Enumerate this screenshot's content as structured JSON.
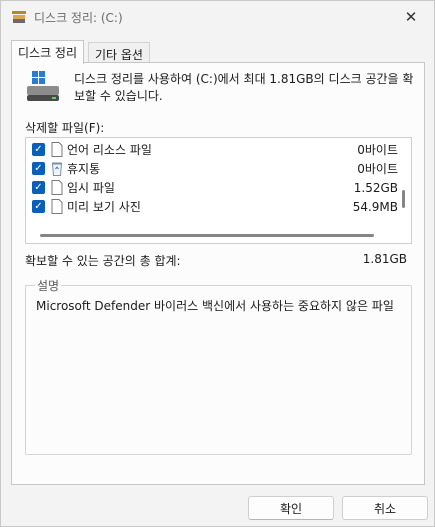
{
  "window": {
    "title": "디스크 정리: (C:)",
    "close_glyph": "✕",
    "icon": "disk-cleanup-icon"
  },
  "tabs": [
    {
      "label": "디스크 정리",
      "active": true
    },
    {
      "label": "기타 옵션",
      "active": false
    }
  ],
  "panel": {
    "intro_text": "디스크 정리를 사용하여 (C:)에서 최대 1.81GB의 디스크 공간을 확보할 수 있습니다.",
    "files_label": "삭제할 파일(F):",
    "files": [
      {
        "name": "언어 리소스 파일",
        "size": "0바이트",
        "checked": true,
        "icon": "file-icon"
      },
      {
        "name": "휴지통",
        "size": "0바이트",
        "checked": true,
        "icon": "recycle-bin-icon"
      },
      {
        "name": "임시 파일",
        "size": "1.52GB",
        "checked": true,
        "icon": "file-icon"
      },
      {
        "name": "미리 보기 사진",
        "size": "54.9MB",
        "checked": true,
        "icon": "file-icon"
      }
    ],
    "total_label": "확보할 수 있는 공간의 총 합계:",
    "total_value": "1.81GB",
    "description_title": "설명",
    "description_text": "Microsoft Defender 바이러스 백신에서 사용하는 중요하지 않은 파일"
  },
  "buttons": {
    "ok": "확인",
    "cancel": "취소"
  },
  "colors": {
    "checkbox": "#0b5fb8",
    "window_bg": "#f3f3f3",
    "panel_bg": "#fcfcfc"
  }
}
